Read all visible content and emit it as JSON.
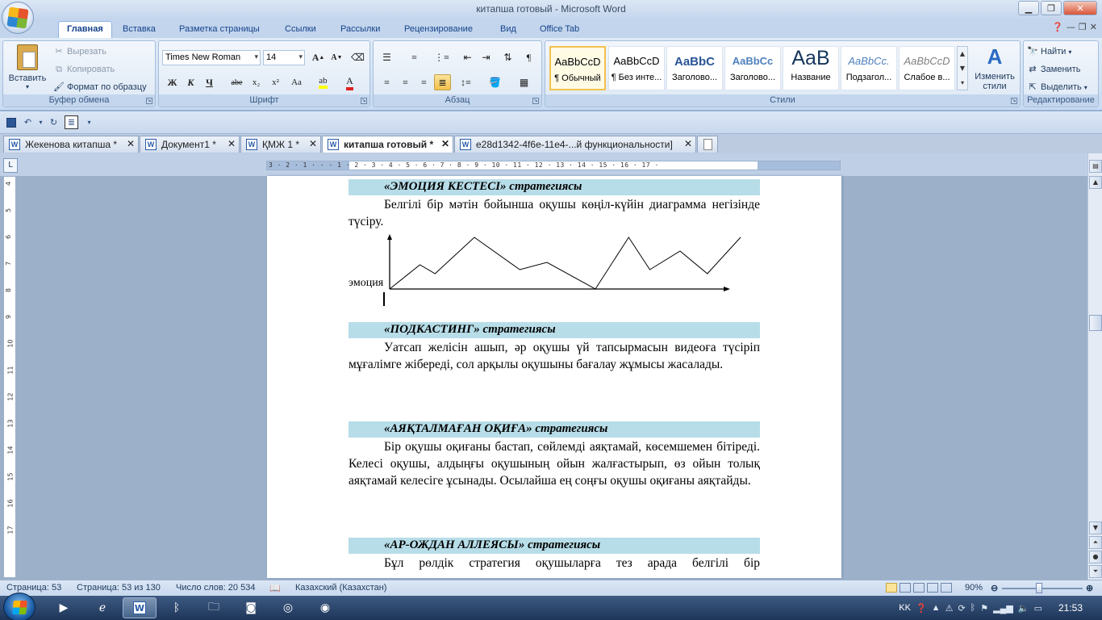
{
  "window": {
    "title": "китапша готовый - Microsoft Word"
  },
  "ribbon_tabs": [
    "Главная",
    "Вставка",
    "Разметка страницы",
    "Ссылки",
    "Рассылки",
    "Рецензирование",
    "Вид",
    "Office Tab"
  ],
  "clipboard": {
    "paste": "Вставить",
    "cut": "Вырезать",
    "copy": "Копировать",
    "format_painter": "Формат по образцу",
    "label": "Буфер обмена"
  },
  "font": {
    "family": "Times New Roman",
    "size": "14",
    "label": "Шрифт",
    "bold": "Ж",
    "italic": "К",
    "underline": "Ч",
    "strike": "abe",
    "subscript": "x₂",
    "superscript": "x²",
    "case": "Aa",
    "grow": "A",
    "shrink": "A"
  },
  "paragraph": {
    "label": "Абзац"
  },
  "styles": {
    "label": "Стили",
    "items": [
      {
        "sample": "AaBbCcD",
        "name": "¶ Обычный"
      },
      {
        "sample": "AaBbCcD",
        "name": "¶ Без инте..."
      },
      {
        "sample": "AaBbC",
        "name": "Заголово..."
      },
      {
        "sample": "AaBbCc",
        "name": "Заголово..."
      },
      {
        "sample": "AaB",
        "name": "Название"
      },
      {
        "sample": "AaBbCc.",
        "name": "Подзагол..."
      },
      {
        "sample": "AaBbCcD",
        "name": "Слабое в..."
      }
    ],
    "change_styles": "Изменить стили"
  },
  "editing": {
    "label": "Редактирование",
    "find": "Найти",
    "replace": "Заменить",
    "select": "Выделить"
  },
  "doc_tabs": [
    {
      "title": "Жекенова китапша *"
    },
    {
      "title": "Документ1 *"
    },
    {
      "title": "ҚМЖ 1 *"
    },
    {
      "title": "китапша готовый *"
    },
    {
      "title": "e28d1342-4f6e-11e4-...й функциональности]"
    }
  ],
  "ruler": {
    "text": "3 · 2 · 1 · · · 1 · 2 · 3 · 4 · 5 · 6 · 7 · 8 · 9 · 10 · 11 · 12 · 13 · 14 · 15 · 16 · 17 ·"
  },
  "vruler_numbers": [
    "4",
    "5",
    "6",
    "7",
    "8",
    "9",
    "10",
    "11",
    "12",
    "13",
    "14",
    "15",
    "16",
    "17"
  ],
  "document": {
    "s1_title": "«ЭМОЦИЯ КЕСТЕСІ» стратегиясы",
    "s1_text": "Белгілі бір мәтін бойынша оқушы көңіл-күйін диаграмма негізінде түсіру.",
    "chart_label": "эмоция",
    "s2_title": "«ПОДКАСТИНГ» стратегиясы",
    "s2_text": "Уатсап желісін ашып, әр оқушы үй тапсырмасын видеоға түсіріп мұғалімге жібереді, сол арқылы оқушыны бағалау жұмысы жасалады.",
    "s3_title": "«АЯҚТАЛМАҒАН ОҚИҒА» стратегиясы",
    "s3_text": "Бір оқушы оқиғаны бастап, сөйлемді аяқтамай, көсемшемен бітіреді. Келесі оқушы, алдыңғы оқушының ойын жалғастырып, өз ойын толық аяқтамай келесіге ұсынады. Осылайша ең соңғы оқушы оқиғаны аяқтайды.",
    "s4_title": "«АР-ОЖДАН АЛЛЕЯСЫ» стратегиясы",
    "s4_text": "Бұл рөлдік стратегия оқушыларға тез арада белгілі бір"
  },
  "emotion_chart": {
    "points": [
      [
        0,
        0
      ],
      [
        1,
        3
      ],
      [
        1.5,
        1.9
      ],
      [
        2.8,
        6.4
      ],
      [
        4.3,
        2.4
      ],
      [
        5.2,
        3.3
      ],
      [
        6.8,
        0
      ],
      [
        7.9,
        6.4
      ],
      [
        8.6,
        2.4
      ],
      [
        9.6,
        4.7
      ],
      [
        10.5,
        1.9
      ],
      [
        11.6,
        6.4
      ]
    ]
  },
  "status": {
    "page": "Страница: 53",
    "page_of": "Страница: 53 из 130",
    "words": "Число слов: 20 534",
    "language": "Казахский (Казахстан)",
    "zoom": "90%"
  },
  "tray": {
    "lang": "KK",
    "time": "21:53"
  }
}
